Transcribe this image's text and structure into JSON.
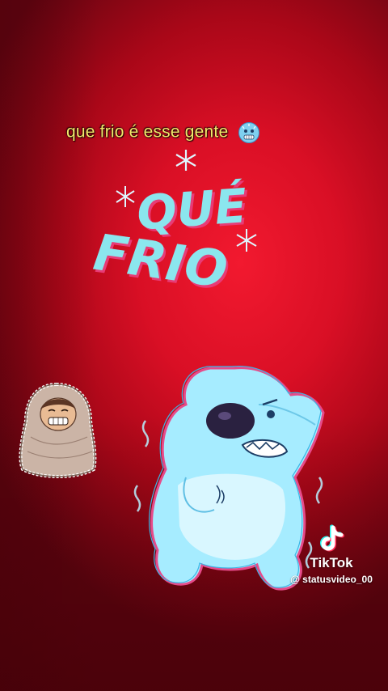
{
  "caption": {
    "text": "que frio é esse gente",
    "emoji": "cold-face-emoji"
  },
  "stickers": {
    "title_lines": [
      "QUÉ",
      "FRIO"
    ],
    "icons": [
      "snowflake-icon",
      "bundled-person",
      "shivering-polar-bear"
    ]
  },
  "watermark": {
    "brand": "TikTok",
    "handle": "@ statusvideo_00",
    "icon": "tiktok-note-icon"
  },
  "colors": {
    "background": "#d90f25",
    "caption": "#f5e86a",
    "ice_blue": "#7fd8f5",
    "bear_blue": "#a6ecff"
  }
}
